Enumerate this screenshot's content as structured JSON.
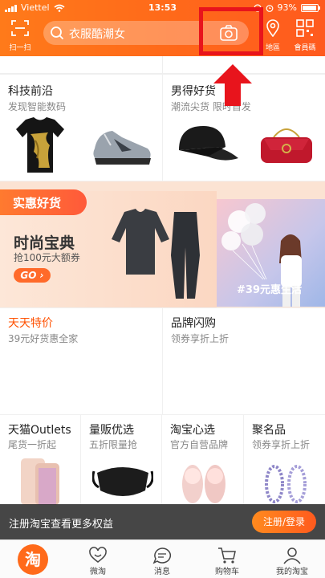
{
  "status": {
    "carrier": "Viettel",
    "time": "13:53",
    "battery": "93%"
  },
  "header": {
    "scan_label": "扫一扫",
    "search_placeholder": "衣服酷潮女",
    "map_label": "地區",
    "qr_label": "會員碼"
  },
  "grid1": [
    {
      "title": "科技前沿",
      "subtitle": "发现智能数码"
    },
    {
      "title": "男得好货",
      "subtitle": "潮流尖货 限时首发"
    }
  ],
  "promo": {
    "tag": "实惠好货",
    "main": "时尚宝典",
    "sub": "抢100元大额券",
    "go": "GO",
    "right_tag": "#39元惠生活"
  },
  "grid2": [
    {
      "title": "天天特价",
      "subtitle": "39元好货惠全家",
      "title_color": "#ff5000"
    },
    {
      "title": "品牌闪购",
      "subtitle": "领券享折上折"
    }
  ],
  "grid3": [
    {
      "title": "天猫Outlets",
      "subtitle": "尾货一折起"
    },
    {
      "title": "量贩优选",
      "subtitle": "五折限量抢"
    },
    {
      "title": "淘宝心选",
      "subtitle": "官方自营品牌"
    },
    {
      "title": "聚名品",
      "subtitle": "领券享折上折"
    }
  ],
  "banner": {
    "text": "注册淘宝查看更多权益",
    "button": "注册/登录"
  },
  "tabs": [
    {
      "label": "淘",
      "icon": "taobao-home-icon"
    },
    {
      "label": "微淘",
      "icon": "weitao-icon"
    },
    {
      "label": "消息",
      "icon": "message-icon"
    },
    {
      "label": "购物车",
      "icon": "cart-icon"
    },
    {
      "label": "我的淘宝",
      "icon": "user-icon"
    }
  ],
  "colors": {
    "brand": "#ff6a1a",
    "highlight": "#e8141c"
  }
}
